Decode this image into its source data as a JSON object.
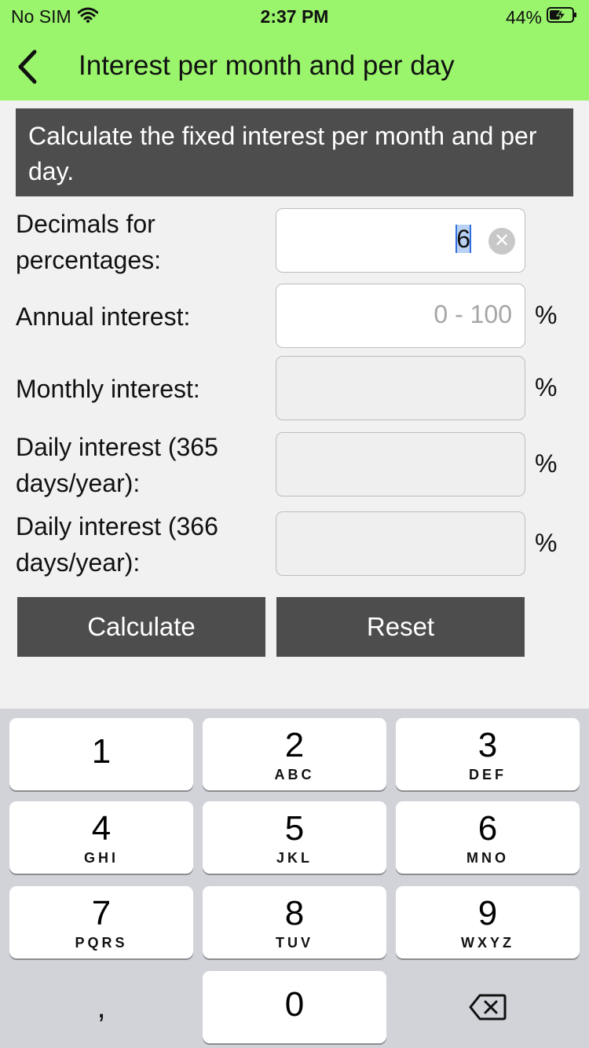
{
  "status": {
    "carrier": "No SIM",
    "time": "2:37 PM",
    "battery": "44%"
  },
  "nav": {
    "title": "Interest per month and per day"
  },
  "info": {
    "text": "Calculate the fixed interest per month and per day."
  },
  "form": {
    "decimals": {
      "label_line1": "Decimals for",
      "label_line2": "percentages:",
      "value": "6"
    },
    "annual": {
      "label": "Annual interest:",
      "placeholder": "0 - 100",
      "unit": "%"
    },
    "monthly": {
      "label": "Monthly interest:",
      "unit": "%"
    },
    "daily365": {
      "label_line1": "Daily interest (365",
      "label_line2": "days/year):",
      "unit": "%"
    },
    "daily366": {
      "label_line1": "Daily interest (366",
      "label_line2": "days/year):",
      "unit": "%"
    }
  },
  "buttons": {
    "calculate": "Calculate",
    "reset": "Reset"
  },
  "keyboard": {
    "keys": [
      {
        "num": "1",
        "letters": ""
      },
      {
        "num": "2",
        "letters": "ABC"
      },
      {
        "num": "3",
        "letters": "DEF"
      },
      {
        "num": "4",
        "letters": "GHI"
      },
      {
        "num": "5",
        "letters": "JKL"
      },
      {
        "num": "6",
        "letters": "MNO"
      },
      {
        "num": "7",
        "letters": "PQRS"
      },
      {
        "num": "8",
        "letters": "TUV"
      },
      {
        "num": "9",
        "letters": "WXYZ"
      },
      {
        "num": "0",
        "letters": ""
      }
    ],
    "comma": ","
  },
  "colors": {
    "header": "#9af56c",
    "dark": "#4d4d4d",
    "keyboard_bg": "#d1d3d9"
  }
}
